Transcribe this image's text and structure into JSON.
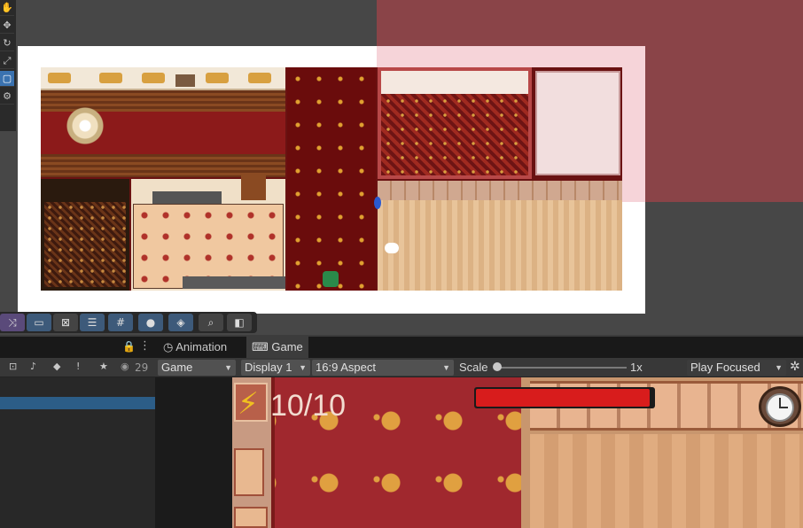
{
  "scene_view": {
    "tools": [
      "tool-rect",
      "tool-move",
      "tool-rotate",
      "tool-scale",
      "tool-rect-transform",
      "tool-custom"
    ],
    "bottom_tools": [
      "grid-snap-icon",
      "box-select-icon",
      "tilemap-icon",
      "align-icon",
      "grid-icon",
      "circle-icon",
      "layers-icon",
      "search-icon",
      "camera-icon"
    ]
  },
  "tabs": [
    {
      "label": "Animation",
      "icon": "animation-icon"
    },
    {
      "label": "Game",
      "icon": "gamepad-icon"
    }
  ],
  "hierarchy": {
    "visible_count": "29"
  },
  "game_toolbar": {
    "display_mode": "Game",
    "display": "Display 1",
    "aspect": "16:9 Aspect",
    "scale_label": "Scale",
    "scale_value": "1x",
    "scale_fraction": 0.0,
    "play_mode": "Play Focused"
  },
  "hud": {
    "energy_text": "10/10",
    "health_fraction": 0.98,
    "health_color": "#d81c1c"
  },
  "colors": {
    "accent": "#3a72b0",
    "camera_overlay": "#8a4448"
  }
}
